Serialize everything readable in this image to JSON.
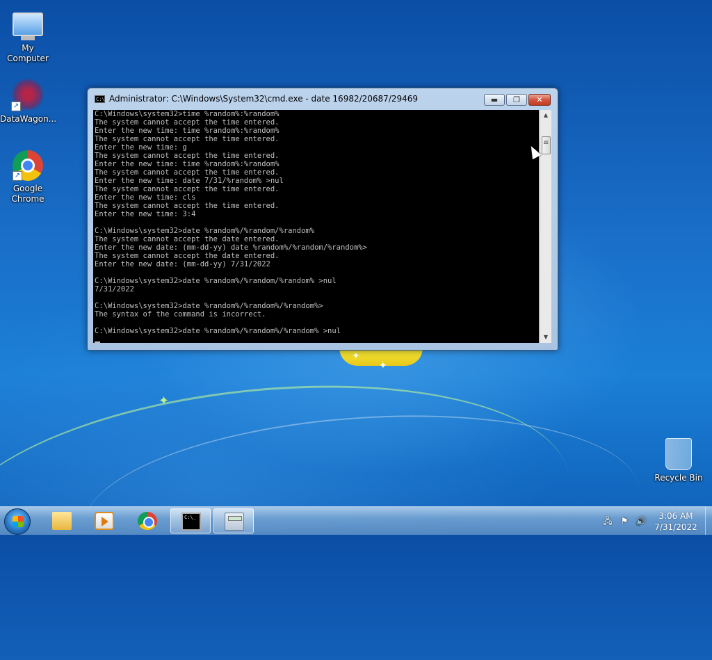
{
  "desktop": {
    "icons": [
      {
        "label": "My Computer",
        "icon": "computer-icon"
      },
      {
        "label": "DataWagon...",
        "icon": "datawagon-icon"
      },
      {
        "label": "Google Chrome",
        "icon": "chrome-icon"
      },
      {
        "label": "Recycle Bin",
        "icon": "recycle-bin-icon"
      }
    ]
  },
  "window": {
    "title": "Administrator: C:\\Windows\\System32\\cmd.exe - date 16982/20687/29469",
    "title_icon_text": "C:\\",
    "controls": {
      "minimize": "▬",
      "maximize": "❐",
      "close": "✕"
    },
    "console_lines": [
      "C:\\Windows\\system32>time %random%:%random%",
      "The system cannot accept the time entered.",
      "Enter the new time: time %random%:%random%",
      "The system cannot accept the time entered.",
      "Enter the new time: g",
      "The system cannot accept the time entered.",
      "Enter the new time: time %random%:%random%",
      "The system cannot accept the time entered.",
      "Enter the new time: date 7/31/%random% >nul",
      "The system cannot accept the time entered.",
      "Enter the new time: cls",
      "The system cannot accept the time entered.",
      "Enter the new time: 3:4",
      "",
      "C:\\Windows\\system32>date %random%/%random/%random%",
      "The system cannot accept the date entered.",
      "Enter the new date: (mm-dd-yy) date %random%/%random/%random%>",
      "The system cannot accept the date entered.",
      "Enter the new date: (mm-dd-yy) 7/31/2022",
      "",
      "C:\\Windows\\system32>date %random%/%random/%random% >nul",
      "7/31/2022",
      "",
      "C:\\Windows\\system32>date %random%/%random%/%random%>",
      "The syntax of the command is incorrect.",
      "",
      "C:\\Windows\\system32>date %random%/%random%/%random% >nul"
    ]
  },
  "taskbar": {
    "start_icon": "windows-start-icon",
    "buttons": [
      {
        "name": "file-explorer",
        "icon": "folder-icon",
        "active": false
      },
      {
        "name": "media-player",
        "icon": "media-player-icon",
        "active": false
      },
      {
        "name": "google-chrome",
        "icon": "chrome-icon",
        "active": false
      },
      {
        "name": "command-prompt",
        "icon": "cmd-icon",
        "active": true,
        "icon_text": "C:\\_"
      },
      {
        "name": "calculator",
        "icon": "calculator-icon",
        "active": false
      }
    ],
    "tray": {
      "icons": [
        "network-icon",
        "action-center-flag-icon",
        "volume-icon"
      ],
      "time": "3:06 AM",
      "date": "7/31/2022"
    }
  }
}
